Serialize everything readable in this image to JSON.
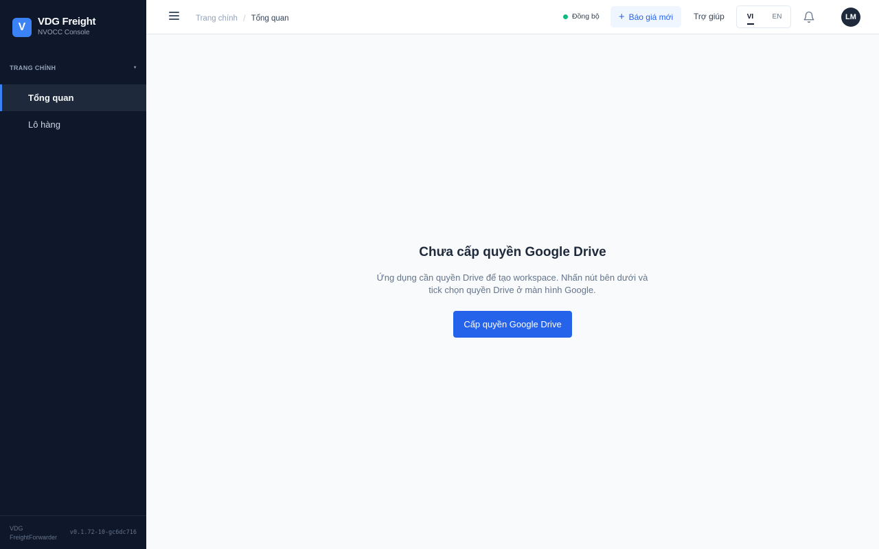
{
  "brand": {
    "logo_letter": "V",
    "title": "VDG Freight",
    "subtitle": "NVOCC Console"
  },
  "sidebar": {
    "section_title": "TRANG CHÍNH",
    "items": [
      {
        "label": "Tổng quan",
        "active": true
      },
      {
        "label": "Lô hàng",
        "active": false
      }
    ],
    "footer": {
      "app_name": "VDG FreightForwarder",
      "version": "v0.1.72-10-gc6dc716"
    }
  },
  "header": {
    "breadcrumb": {
      "parent": "Trang chính",
      "separator": "/",
      "current": "Tổng quan"
    },
    "sync_label": "Đồng bộ",
    "new_quote_label": "Báo giá mới",
    "help_label": "Trợ giúp",
    "languages": [
      {
        "code": "VI",
        "active": true
      },
      {
        "code": "EN",
        "active": false
      }
    ],
    "avatar_initials": "LM"
  },
  "main": {
    "empty_title": "Chưa cấp quyền Google Drive",
    "empty_description": "Ứng dụng cần quyền Drive để tạo workspace. Nhấn nút bên dưới và tick chọn quyền Drive ở màn hình Google.",
    "grant_button_label": "Cấp quyền Google Drive"
  },
  "colors": {
    "sidebar_bg": "#0f172a",
    "accent": "#2563eb",
    "sync_status": "#10b981"
  },
  "icons": {
    "menu": "hamburger-icon",
    "plus": "plus-icon",
    "bell": "bell-icon",
    "caret": "caret-down-icon",
    "status": "status-dot-icon"
  }
}
